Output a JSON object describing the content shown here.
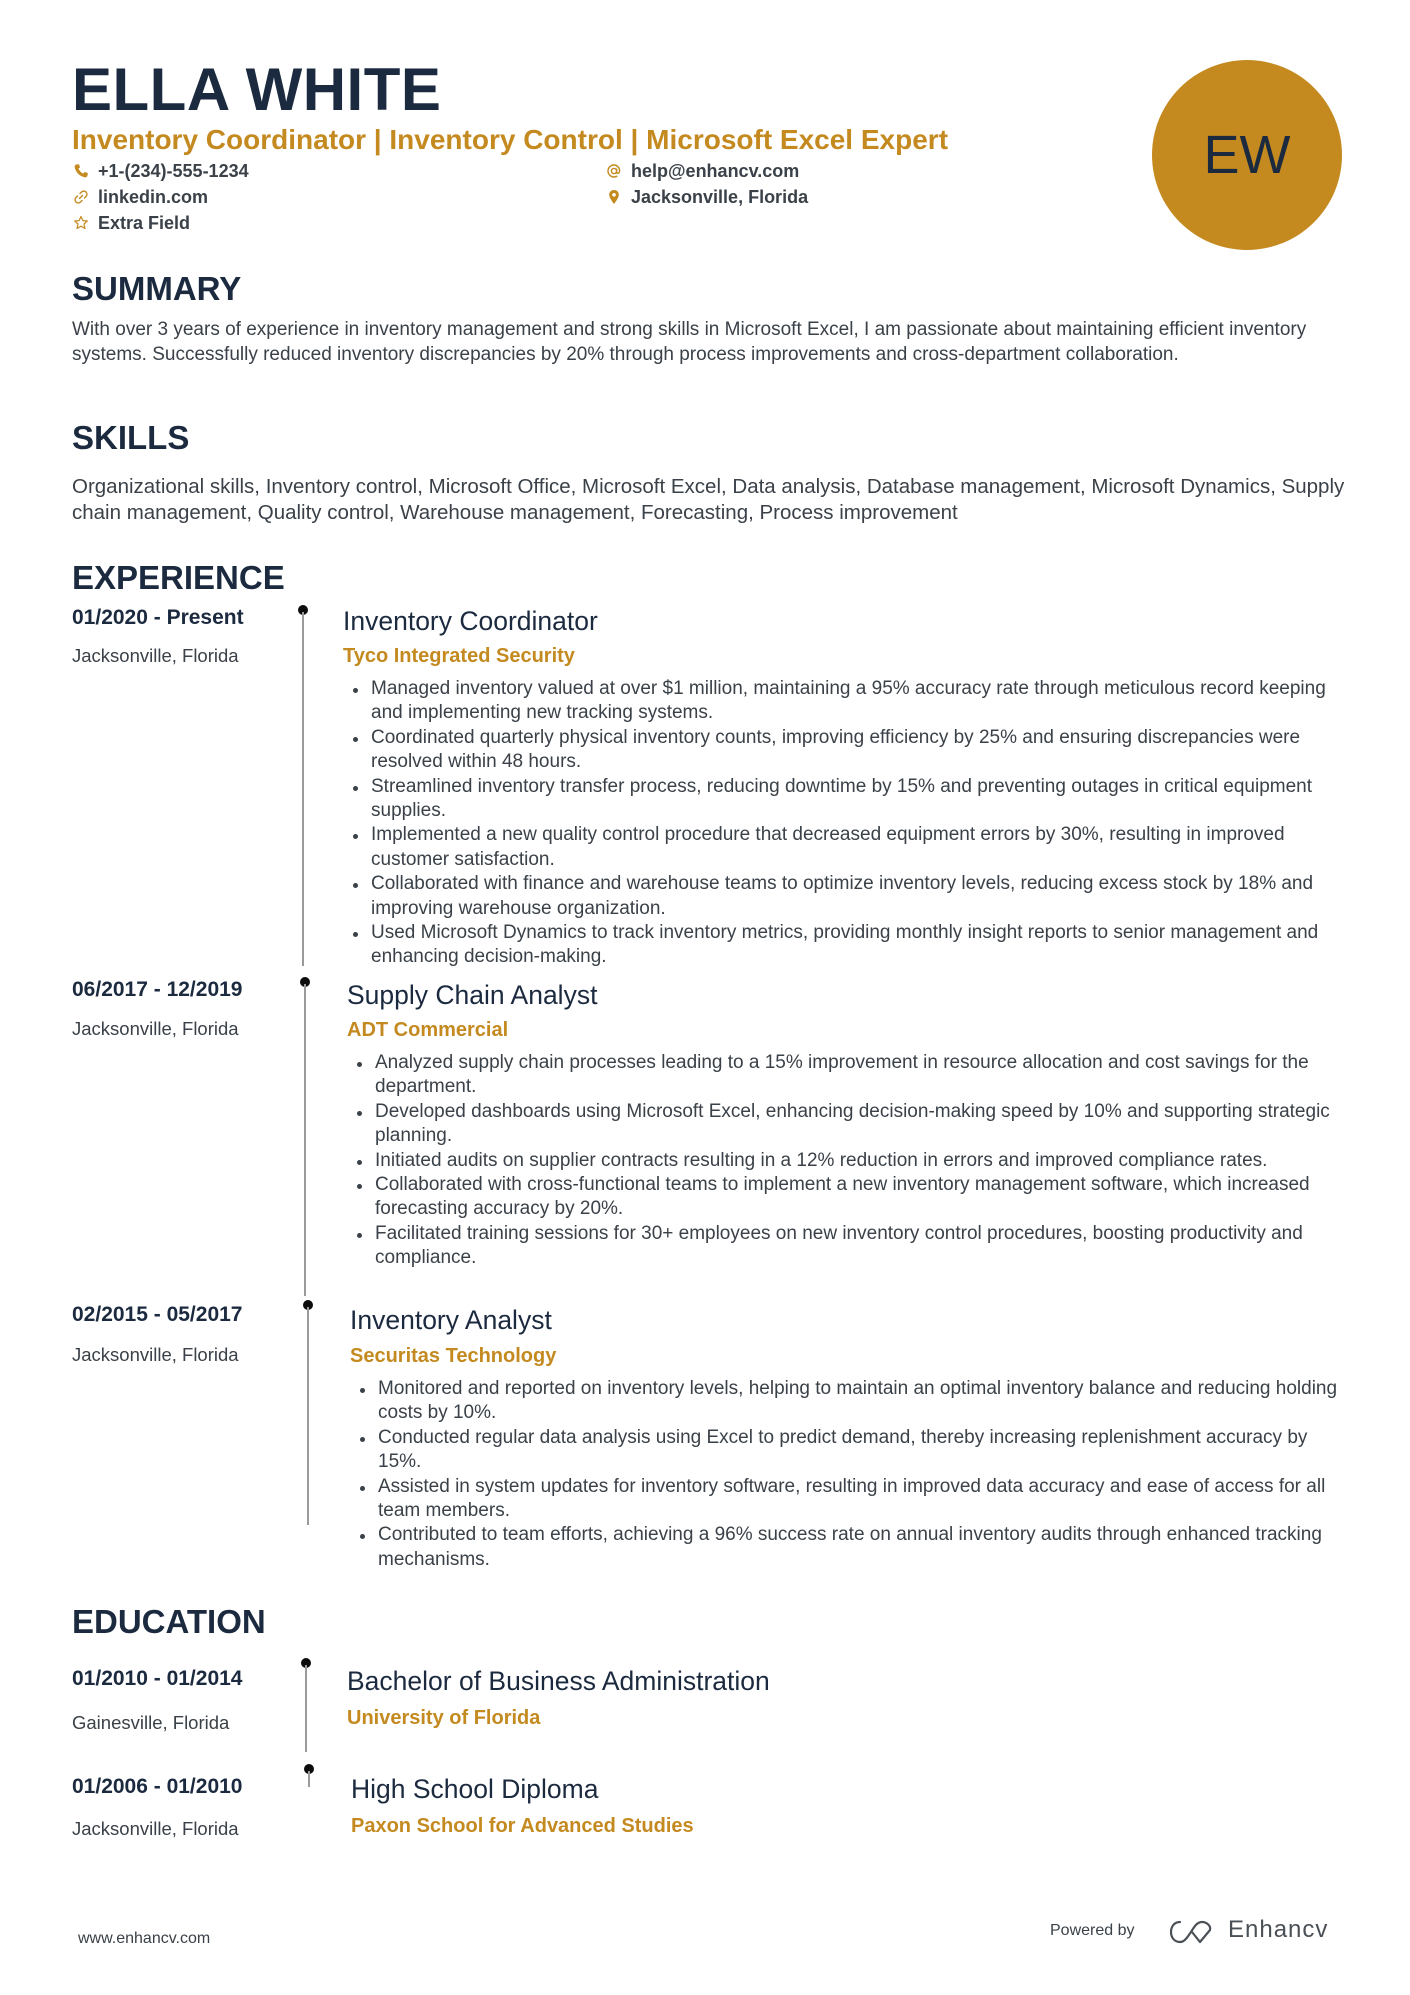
{
  "header": {
    "name": "ELLA WHITE",
    "headline": "Inventory Coordinator | Inventory Control | Microsoft Excel Expert",
    "initials": "EW",
    "contacts": [
      {
        "icon": "phone-icon",
        "text": "+1-(234)-555-1234"
      },
      {
        "icon": "email-icon",
        "text": "help@enhancv.com"
      },
      {
        "icon": "link-icon",
        "text": "linkedin.com"
      },
      {
        "icon": "location-pin-icon",
        "text": "Jacksonville, Florida"
      },
      {
        "icon": "star-icon",
        "text": "Extra Field"
      }
    ]
  },
  "colors": {
    "accent": "#c48a20",
    "heading": "#1c2a3f",
    "text": "#3a4148"
  },
  "summary": {
    "title": "SUMMARY",
    "text": "With over 3 years of experience in inventory management and strong skills in Microsoft Excel, I am passionate about maintaining efficient inventory systems. Successfully reduced inventory discrepancies by 20% through process improvements and cross-department collaboration."
  },
  "skills": {
    "title": "SKILLS",
    "text": "Organizational skills, Inventory control, Microsoft Office, Microsoft Excel, Data analysis, Database management, Microsoft Dynamics, Supply chain management, Quality control, Warehouse management, Forecasting, Process improvement"
  },
  "experience": {
    "title": "EXPERIENCE",
    "entries": [
      {
        "dates": "01/2020 - Present",
        "location": "Jacksonville, Florida",
        "role": "Inventory Coordinator",
        "company": "Tyco Integrated Security",
        "bullets": [
          "Managed inventory valued at over $1 million, maintaining a 95% accuracy rate through meticulous record keeping and implementing new tracking systems.",
          "Coordinated quarterly physical inventory counts, improving efficiency by 25% and ensuring discrepancies were resolved within 48 hours.",
          "Streamlined inventory transfer process, reducing downtime by 15% and preventing outages in critical equipment supplies.",
          "Implemented a new quality control procedure that decreased equipment errors by 30%, resulting in improved customer satisfaction.",
          "Collaborated with finance and warehouse teams to optimize inventory levels, reducing excess stock by 18% and improving warehouse organization.",
          "Used Microsoft Dynamics to track inventory metrics, providing monthly insight reports to senior management and enhancing decision-making."
        ]
      },
      {
        "dates": "06/2017 - 12/2019",
        "location": "Jacksonville, Florida",
        "role": "Supply Chain Analyst",
        "company": "ADT Commercial",
        "bullets": [
          "Analyzed supply chain processes leading to a 15% improvement in resource allocation and cost savings for the department.",
          "Developed dashboards using Microsoft Excel, enhancing decision-making speed by 10% and supporting strategic planning.",
          "Initiated audits on supplier contracts resulting in a 12% reduction in errors and improved compliance rates.",
          "Collaborated with cross-functional teams to implement a new inventory management software, which increased forecasting accuracy by 20%.",
          "Facilitated training sessions for 30+ employees on new inventory control procedures, boosting productivity and compliance."
        ]
      },
      {
        "dates": "02/2015 - 05/2017",
        "location": "Jacksonville, Florida",
        "role": "Inventory Analyst",
        "company": "Securitas Technology",
        "bullets": [
          "Monitored and reported on inventory levels, helping to maintain an optimal inventory balance and reducing holding costs by 10%.",
          "Conducted regular data analysis using Excel to predict demand, thereby increasing replenishment accuracy by 15%.",
          "Assisted in system updates for inventory software, resulting in improved data accuracy and ease of access for all team members.",
          "Contributed to team efforts, achieving a 96% success rate on annual inventory audits through enhanced tracking mechanisms."
        ]
      }
    ]
  },
  "education": {
    "title": "EDUCATION",
    "entries": [
      {
        "dates": "01/2010 - 01/2014",
        "location": "Gainesville, Florida",
        "degree": "Bachelor of Business Administration",
        "school": "University of Florida"
      },
      {
        "dates": "01/2006 - 01/2010",
        "location": "Jacksonville, Florida",
        "degree": "High School Diploma",
        "school": "Paxon School for Advanced Studies"
      }
    ]
  },
  "footer": {
    "website": "www.enhancv.com",
    "powered_by": "Powered by",
    "brand": "Enhancv"
  }
}
